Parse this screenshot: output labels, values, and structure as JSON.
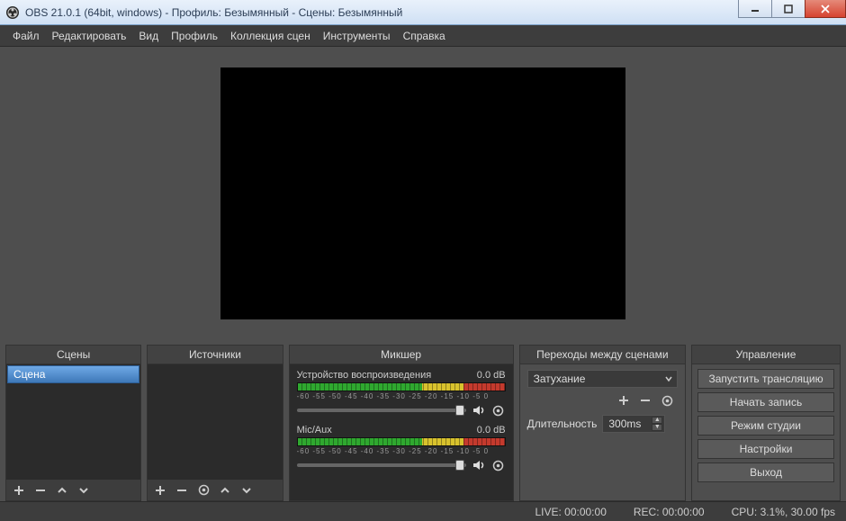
{
  "window": {
    "title": "OBS 21.0.1 (64bit, windows) - Профиль: Безымянный - Сцены: Безымянный"
  },
  "menu": {
    "file": "Файл",
    "edit": "Редактировать",
    "view": "Вид",
    "profile": "Профиль",
    "scene_collection": "Коллекция сцен",
    "tools": "Инструменты",
    "help": "Справка"
  },
  "panels": {
    "scenes": {
      "title": "Сцены",
      "items": [
        "Сцена"
      ]
    },
    "sources": {
      "title": "Источники"
    },
    "mixer": {
      "title": "Микшер",
      "scale": "-60 -55 -50 -45 -40 -35 -30 -25 -20 -15 -10 -5 0",
      "channels": [
        {
          "name": "Устройство воспроизведения",
          "level": "0.0 dB"
        },
        {
          "name": "Mic/Aux",
          "level": "0.0 dB"
        }
      ]
    },
    "transitions": {
      "title": "Переходы между сценами",
      "selected": "Затухание",
      "duration_label": "Длительность",
      "duration_value": "300ms"
    },
    "controls": {
      "title": "Управление",
      "buttons": {
        "start_stream": "Запустить трансляцию",
        "start_record": "Начать запись",
        "studio_mode": "Режим студии",
        "settings": "Настройки",
        "exit": "Выход"
      }
    }
  },
  "status": {
    "live": "LIVE: 00:00:00",
    "rec": "REC: 00:00:00",
    "cpu": "CPU: 3.1%, 30.00 fps"
  }
}
